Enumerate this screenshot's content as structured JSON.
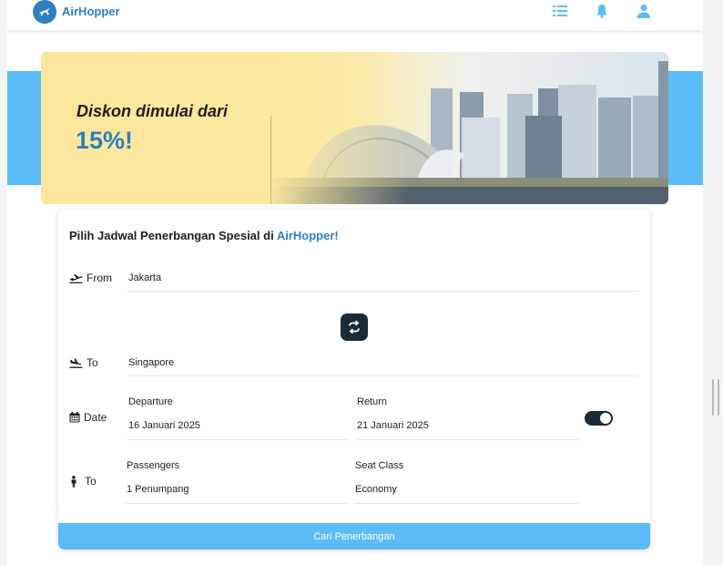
{
  "header": {
    "brand": "AirHopper",
    "icons": [
      "list-icon",
      "bell-icon",
      "user-icon"
    ]
  },
  "banner": {
    "line1": "Diskon dimulai dari",
    "line2": "15%!"
  },
  "form": {
    "title_prefix": "Pilih Jadwal Penerbangan Spesial di ",
    "title_brand": "AirHopper!",
    "from": {
      "label": "From",
      "value": "Jakarta"
    },
    "to": {
      "label": "To",
      "value": "Singapore"
    },
    "date": {
      "label": "Date",
      "departure_caption": "Departure",
      "departure_value": "16 Januari 2025",
      "return_caption": "Return",
      "return_value": "21 Januari 2025"
    },
    "passenger_row": {
      "label": "To",
      "passengers_caption": "Passengers",
      "passengers_value": "1 Penumpang",
      "seat_caption": "Seat Class",
      "seat_value": "Economy"
    },
    "return_toggle_on": true,
    "submit_label": "Cari Penerbangan"
  },
  "colors": {
    "brand": "#2f7fbf",
    "accent_band": "#5bbcf8",
    "dark": "#1c2a36"
  }
}
